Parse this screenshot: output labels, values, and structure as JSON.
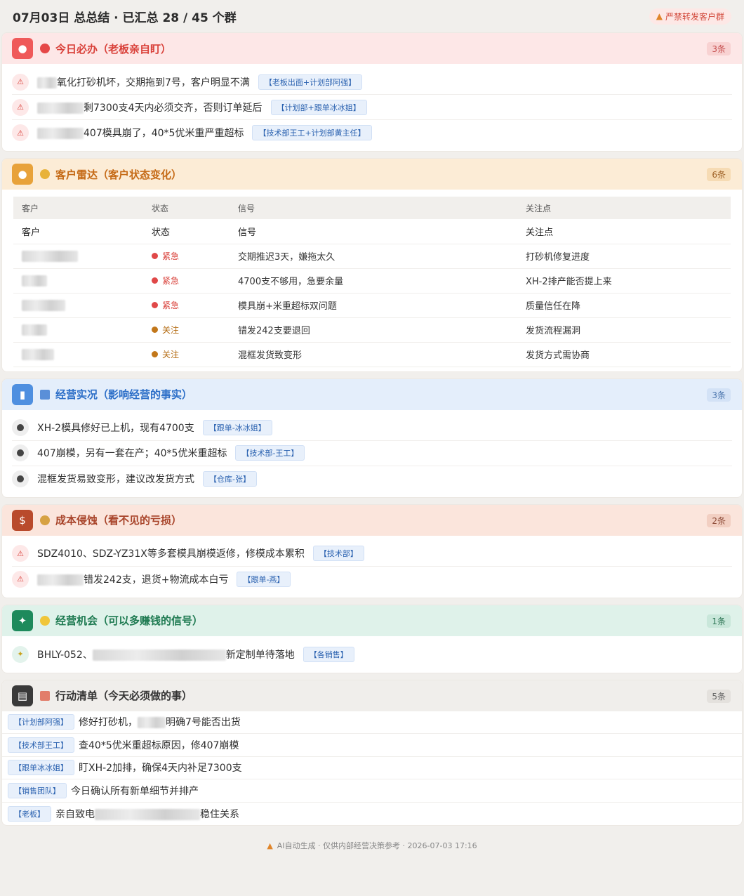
{
  "header": {
    "title": "07月03日 总总结 · 已汇总 28 / 45 个群",
    "warning": "严禁转发客户群"
  },
  "urgent": {
    "title": "今日必办（老板亲自盯）",
    "count": "3条",
    "items": [
      {
        "text_a": "",
        "text_b": "氧化打砂机坏，交期拖到7号，客户明显不满",
        "tag": "【老板出面+计划部阿强】"
      },
      {
        "text_a": "",
        "text_b": "剩7300支4天内必须交齐，否则订单延后",
        "tag": "【计划部+跟单冰冰姐】"
      },
      {
        "text_a": "",
        "text_b": "407模具崩了，40*5优米重严重超标",
        "tag": "【技术部王工+计划部黄主任】"
      }
    ]
  },
  "radar": {
    "title": "客户雷达（客户状态变化）",
    "count": "6条",
    "columns": [
      "客户",
      "状态",
      "信号",
      "关注点"
    ],
    "subheader": [
      "客户",
      "状态",
      "信号",
      "关注点"
    ],
    "rows": [
      {
        "status": "紧急",
        "level": "urgent",
        "signal": "交期推迟3天，嫌拖太久",
        "focus": "打砂机修复进度"
      },
      {
        "status": "紧急",
        "level": "urgent",
        "signal": "4700支不够用，急要余量",
        "focus": "XH-2排产能否提上来"
      },
      {
        "status": "紧急",
        "level": "urgent",
        "signal": "模具崩+米重超标双问题",
        "focus": "质量信任在降"
      },
      {
        "status": "关注",
        "level": "watch",
        "signal": "错发242支要退回",
        "focus": "发货流程漏洞"
      },
      {
        "status": "关注",
        "level": "watch",
        "signal": "混框发货致变形",
        "focus": "发货方式需协商"
      }
    ]
  },
  "facts": {
    "title": "经营实况（影响经营的事实）",
    "count": "3条",
    "items": [
      {
        "text": "XH-2模具修好已上机，现有4700支",
        "tag": "【跟单-冰冰姐】"
      },
      {
        "text": "407崩模，另有一套在产；40*5优米重超标",
        "tag": "【技术部-王工】"
      },
      {
        "text": "混框发货易致变形，建议改发货方式",
        "tag": "【仓库-张】"
      }
    ]
  },
  "cost": {
    "title": "成本侵蚀（看不见的亏损）",
    "count": "2条",
    "items": [
      {
        "text": "SDZ4010、SDZ-YZ31X等多套模具崩模返修，修模成本累积",
        "tag": "【技术部】"
      },
      {
        "text": "错发242支，退货+物流成本白亏",
        "tag": "【跟单-燕】"
      }
    ]
  },
  "opportunity": {
    "title": "经营机会（可以多赚钱的信号）",
    "count": "1条",
    "items": [
      {
        "text_a": "BHLY-052、",
        "text_b": "新定制单待落地",
        "tag": "【各销售】"
      }
    ]
  },
  "actions": {
    "title": "行动清单（今天必须做的事）",
    "count": "5条",
    "items": [
      {
        "tag": "【计划部阿强】",
        "text_a": "修好打砂机，",
        "text_b": "明确7号能否出货"
      },
      {
        "tag": "【技术部王工】",
        "text_a": "查40*5优米重超标原因，修407崩模",
        "text_b": ""
      },
      {
        "tag": "【跟单冰冰姐】",
        "text_a": "盯XH-2加排，确保4天内补足7300支",
        "text_b": ""
      },
      {
        "tag": "【销售团队】",
        "text_a": "今日确认所有新单细节并排产",
        "text_b": ""
      },
      {
        "tag": "【老板】",
        "text_a": "亲自致电",
        "text_b": "稳住关系"
      }
    ]
  },
  "footer": {
    "text": "AI自动生成 · 仅供内部经营决策参考 · 2026-07-03 17:16"
  },
  "colors": {
    "urgent": "#d9413a",
    "orange": "#c56a16",
    "blue": "#2d6fc8",
    "brown": "#a8442a",
    "green": "#1e7a51"
  }
}
